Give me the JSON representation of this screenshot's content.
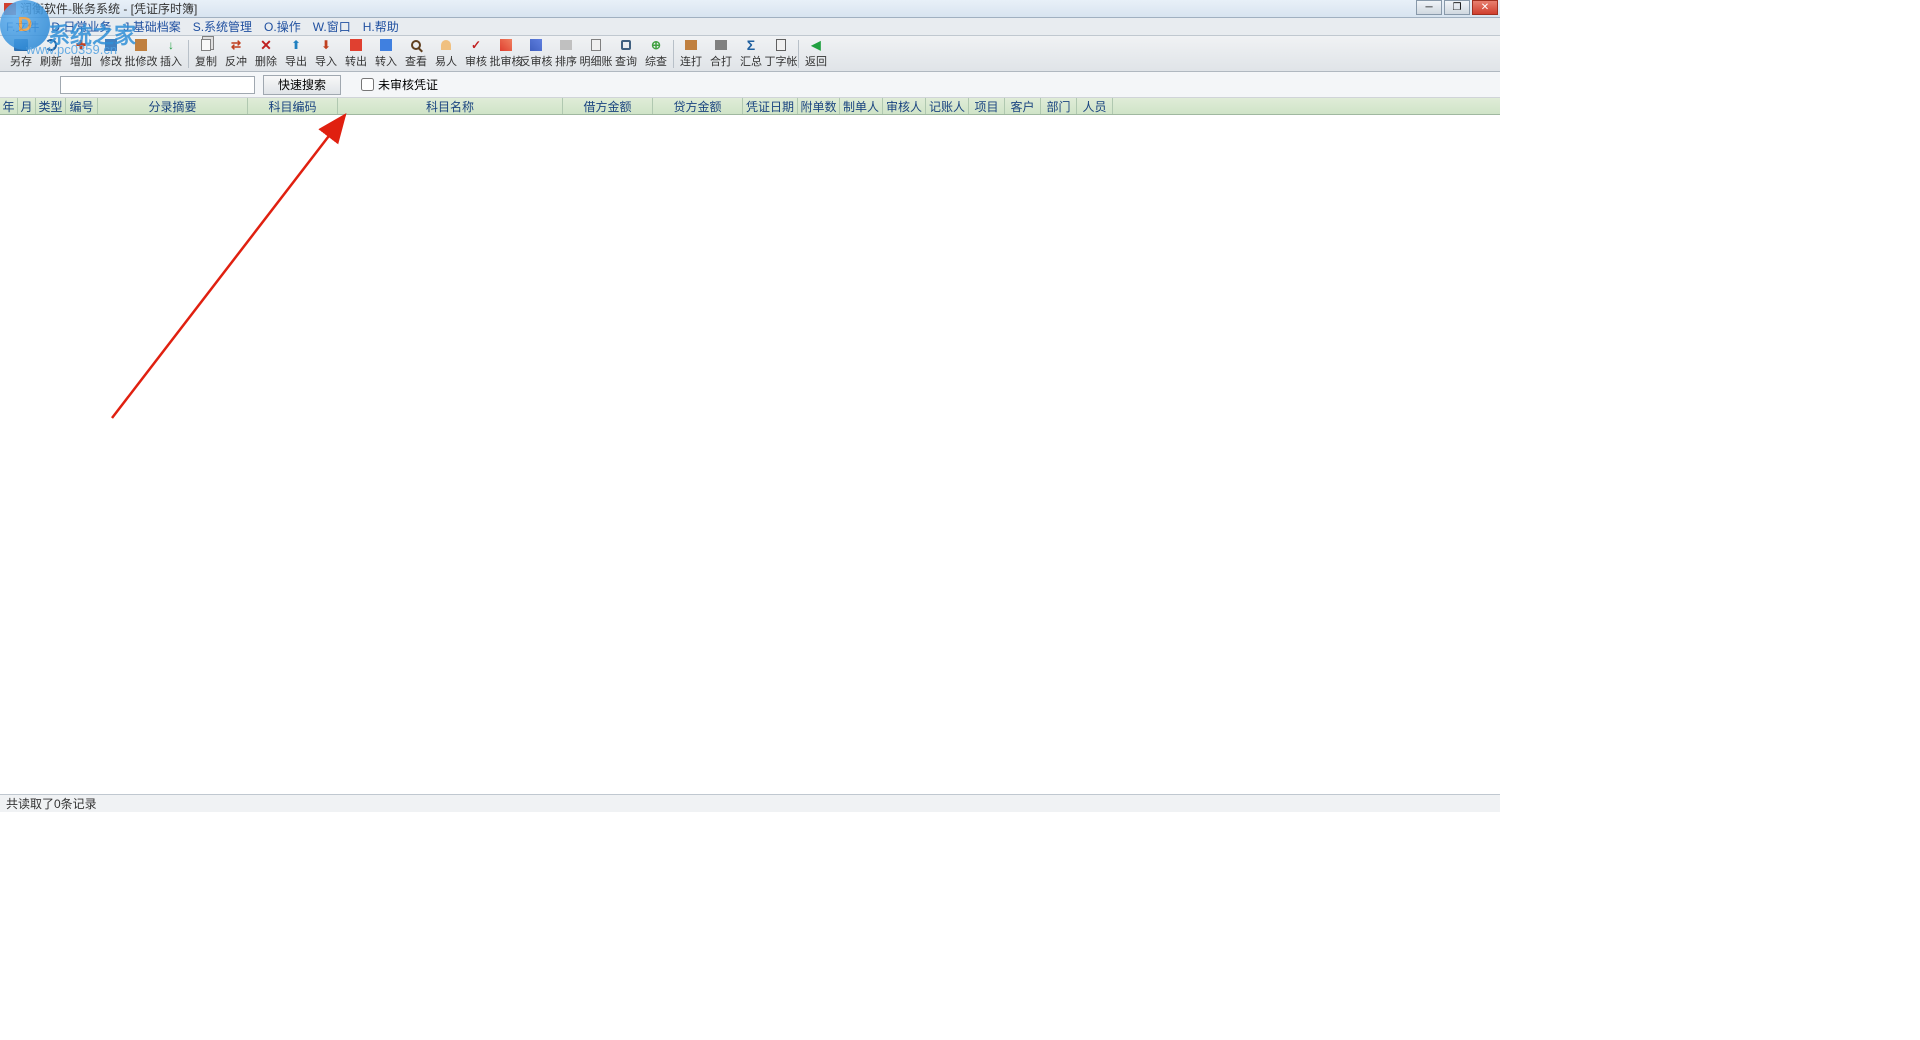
{
  "title": "润衡软件-账务系统 - [凭证序时簿]",
  "menu": {
    "file": "F.文件",
    "daily": "D.日常业务",
    "basic": "J.基础档案",
    "system": "S.系统管理",
    "operate": "O.操作",
    "window": "W.窗口",
    "help": "H.帮助"
  },
  "toolbar": {
    "save": "另存",
    "refresh": "刷新",
    "add": "增加",
    "edit": "修改",
    "batchedit": "批修改",
    "insert": "插入",
    "copy": "复制",
    "reverse": "反冲",
    "delete": "删除",
    "export": "导出",
    "import": "导入",
    "transferout": "转出",
    "transferin": "转入",
    "view": "查看",
    "person": "易人",
    "audit": "审核",
    "batchaudit": "批审核",
    "unaudit": "反审核",
    "sort": "排序",
    "ledger": "明细账",
    "query": "查询",
    "check": "综查",
    "link": "连打",
    "merge": "合打",
    "sum": "汇总",
    "taccount": "丁字帐",
    "back": "返回"
  },
  "search": {
    "placeholder": "",
    "button": "快速搜索",
    "unaudited_label": "未审核凭证"
  },
  "columns": {
    "year": "年",
    "month": "月",
    "type": "类型",
    "number": "编号",
    "summary": "分录摘要",
    "code": "科目编码",
    "name": "科目名称",
    "debit": "借方金额",
    "credit": "贷方金额",
    "date": "凭证日期",
    "attach": "附单数",
    "maker": "制单人",
    "auditor": "审核人",
    "poster": "记账人",
    "project": "项目",
    "customer": "客户",
    "dept": "部门",
    "person": "人员"
  },
  "status": "共读取了0条记录",
  "watermark": {
    "text": "系统之家",
    "url": "www.pc0359.cn"
  }
}
